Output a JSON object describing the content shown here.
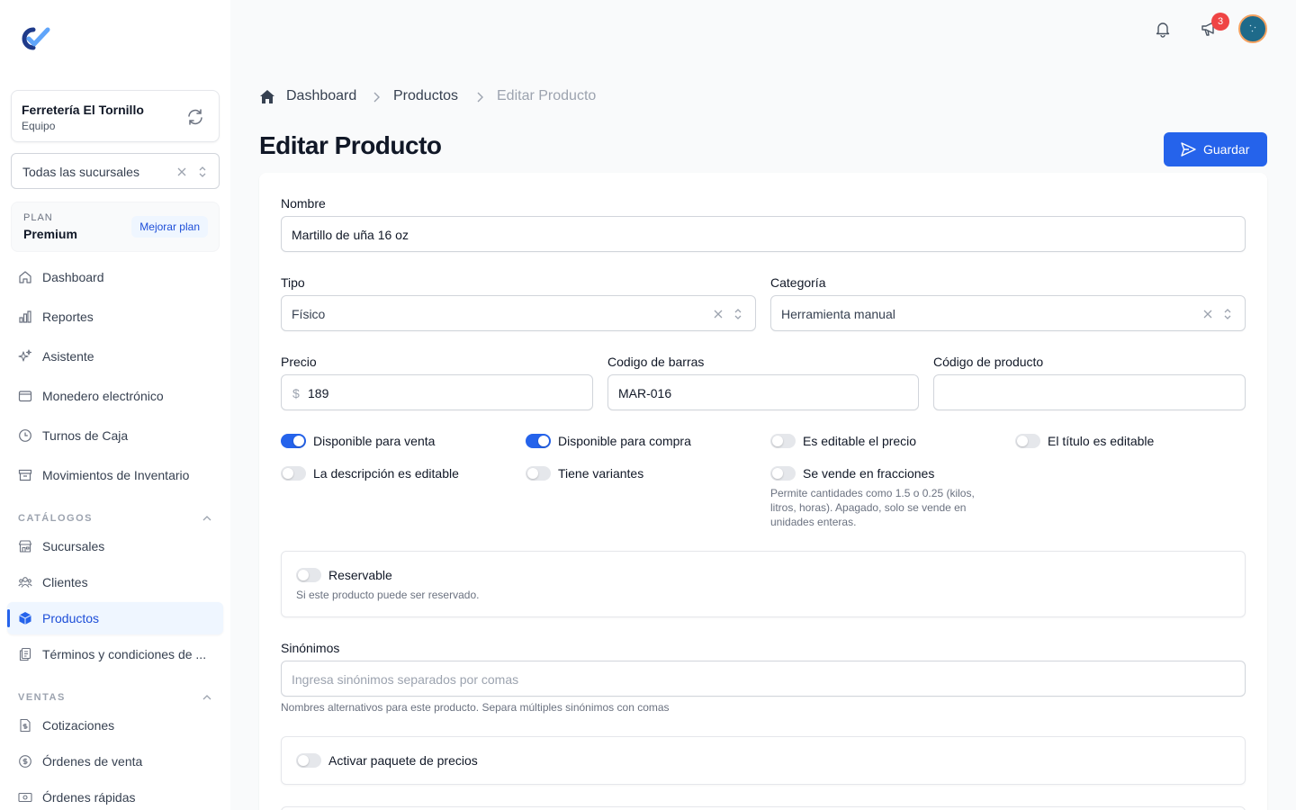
{
  "sidebar": {
    "team": {
      "name": "Ferretería El Tornillo",
      "role": "Equipo"
    },
    "branch_select": {
      "value": "Todas las sucursales"
    },
    "plan": {
      "label": "PLAN",
      "name": "Premium",
      "upgrade": "Mejorar plan"
    },
    "nav": [
      {
        "label": "Dashboard",
        "icon": "home-icon"
      },
      {
        "label": "Reportes",
        "icon": "bar-chart-icon"
      },
      {
        "label": "Asistente",
        "icon": "sparkles-icon"
      },
      {
        "label": "Monedero electrónico",
        "icon": "wallet-icon"
      },
      {
        "label": "Turnos de Caja",
        "icon": "clock-icon"
      },
      {
        "label": "Movimientos de Inventario",
        "icon": "archive-icon"
      }
    ],
    "catalogs": {
      "title": "CATÁLOGOS",
      "items": [
        {
          "label": "Sucursales",
          "icon": "store-icon"
        },
        {
          "label": "Clientes",
          "icon": "users-icon"
        },
        {
          "label": "Productos",
          "icon": "cube-icon",
          "active": true
        },
        {
          "label": "Términos y condiciones de ...",
          "icon": "document-duplicate-icon"
        }
      ]
    },
    "sales": {
      "title": "VENTAS",
      "items": [
        {
          "label": "Cotizaciones",
          "icon": "document-dollar-icon"
        },
        {
          "label": "Órdenes de venta",
          "icon": "dollar-circle-icon"
        },
        {
          "label": "Órdenes rápidas",
          "icon": "banknote-icon"
        }
      ]
    }
  },
  "topbar": {
    "notifications_badge": "3"
  },
  "breadcrumb": [
    "Dashboard",
    "Productos",
    "Editar Producto"
  ],
  "page": {
    "title": "Editar Producto",
    "save_label": "Guardar"
  },
  "form": {
    "nombre": {
      "label": "Nombre",
      "value": "Martillo de uña 16 oz"
    },
    "tipo": {
      "label": "Tipo",
      "value": "Físico"
    },
    "categoria": {
      "label": "Categoría",
      "value": "Herramienta manual"
    },
    "precio": {
      "label": "Precio",
      "prefix": "$",
      "value": "189"
    },
    "codigo_barras": {
      "label": "Codigo de barras",
      "value": "MAR-016"
    },
    "codigo_producto": {
      "label": "Código de producto",
      "value": ""
    },
    "toggles": {
      "disponible_venta": {
        "label": "Disponible para venta",
        "on": true
      },
      "disponible_compra": {
        "label": "Disponible para compra",
        "on": true
      },
      "precio_editable": {
        "label": "Es editable el precio",
        "on": false
      },
      "titulo_editable": {
        "label": "El título es editable",
        "on": false
      },
      "descripcion_editable": {
        "label": "La descripción es editable",
        "on": false
      },
      "variantes": {
        "label": "Tiene variantes",
        "on": false
      },
      "fracciones": {
        "label": "Se vende en fracciones",
        "on": false,
        "help": "Permite cantidades como 1.5 o 0.25 (kilos, litros, horas). Apagado, solo se vende en unidades enteras."
      }
    },
    "reservable": {
      "label": "Reservable",
      "on": false,
      "help": "Si este producto puede ser reservado."
    },
    "sinonimos": {
      "label": "Sinónimos",
      "placeholder": "Ingresa sinónimos separados por comas",
      "help": "Nombres alternativos para este producto. Separa múltiples sinónimos con comas"
    },
    "paquete": {
      "label": "Activar paquete de precios",
      "on": false
    }
  },
  "colors": {
    "primary": "#2563eb",
    "badge": "#ef4444",
    "avatar": "#1e6a8a"
  }
}
